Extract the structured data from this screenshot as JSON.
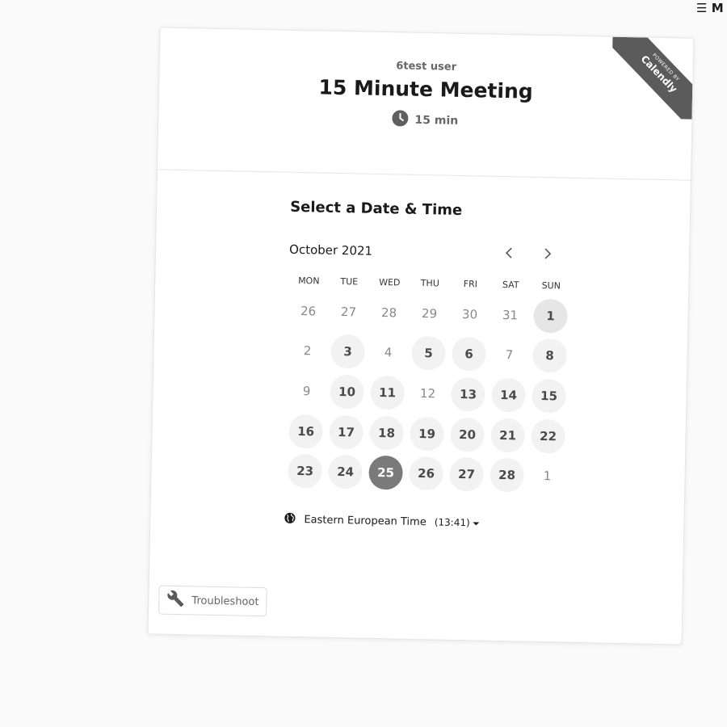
{
  "top_menu": {
    "icon": "hamburger-menu-icon",
    "label": "M"
  },
  "header": {
    "host_name": "6test user",
    "event_title": "15 Minute Meeting",
    "duration": "15 min",
    "duration_icon": "clock-icon"
  },
  "ribbon": {
    "line1": "POWERED BY",
    "line2": "Calendly"
  },
  "calendar": {
    "section_title": "Select a Date & Time",
    "month_label": "October 2021",
    "prev_icon": "chevron-left-icon",
    "next_icon": "chevron-right-icon",
    "weekdays": [
      "MON",
      "TUE",
      "WED",
      "THU",
      "FRI",
      "SAT",
      "SUN"
    ],
    "days": [
      {
        "label": "26",
        "state": "other"
      },
      {
        "label": "27",
        "state": "other"
      },
      {
        "label": "28",
        "state": "other"
      },
      {
        "label": "29",
        "state": "other"
      },
      {
        "label": "30",
        "state": "other"
      },
      {
        "label": "31",
        "state": "other"
      },
      {
        "label": "1",
        "state": "today"
      },
      {
        "label": "2",
        "state": "unavailable"
      },
      {
        "label": "3",
        "state": "available"
      },
      {
        "label": "4",
        "state": "unavailable"
      },
      {
        "label": "5",
        "state": "available"
      },
      {
        "label": "6",
        "state": "available"
      },
      {
        "label": "7",
        "state": "unavailable"
      },
      {
        "label": "8",
        "state": "available"
      },
      {
        "label": "9",
        "state": "unavailable"
      },
      {
        "label": "10",
        "state": "available"
      },
      {
        "label": "11",
        "state": "available"
      },
      {
        "label": "12",
        "state": "unavailable"
      },
      {
        "label": "13",
        "state": "available"
      },
      {
        "label": "14",
        "state": "available"
      },
      {
        "label": "15",
        "state": "available"
      },
      {
        "label": "16",
        "state": "available"
      },
      {
        "label": "17",
        "state": "available"
      },
      {
        "label": "18",
        "state": "available"
      },
      {
        "label": "19",
        "state": "available"
      },
      {
        "label": "20",
        "state": "available"
      },
      {
        "label": "21",
        "state": "available"
      },
      {
        "label": "22",
        "state": "available"
      },
      {
        "label": "23",
        "state": "available"
      },
      {
        "label": "24",
        "state": "available"
      },
      {
        "label": "25",
        "state": "selected"
      },
      {
        "label": "26",
        "state": "available"
      },
      {
        "label": "27",
        "state": "available"
      },
      {
        "label": "28",
        "state": "available"
      },
      {
        "label": "1",
        "state": "other"
      }
    ]
  },
  "timezone": {
    "icon": "globe-icon",
    "name": "Eastern European Time",
    "time": "(13:41)",
    "dropdown_icon": "caret-down-icon"
  },
  "troubleshoot": {
    "icon": "wrench-icon",
    "label": "Troubleshoot"
  },
  "colors": {
    "page_bg": "#fafafa",
    "card_bg": "#ffffff",
    "available_bg": "#f2f2f2",
    "selected_bg": "#7a7a7a",
    "ribbon_bg": "#5b5b5b"
  }
}
